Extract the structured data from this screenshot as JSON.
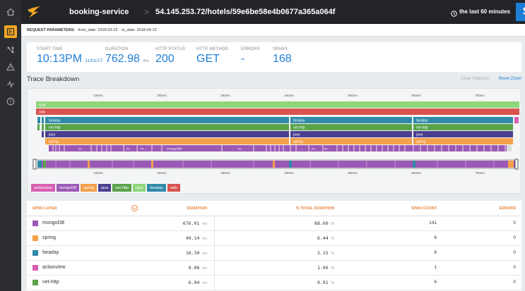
{
  "sidebar": {
    "icons": [
      "home-icon",
      "traces-icon",
      "topology-icon",
      "alerts-icon",
      "metrics-icon",
      "help-icon"
    ]
  },
  "topbar": {
    "service": "booking-service",
    "separator": ">",
    "url": "54.145.253.72/hotels/59e6be58e4b0677a365a064f",
    "time_range": "the last 60 minutes",
    "brand_letter": "S"
  },
  "request": {
    "label": "REQUEST PARAMETERS:",
    "from": "from_date: 2018-03-23",
    "to": "to_date: 2018-04-13"
  },
  "summary": {
    "start_time_label": "START TIME",
    "start_time": "10:13PM",
    "start_date": "11/01/17",
    "duration_label": "DURATION",
    "duration": "762.98",
    "duration_unit": "ms",
    "http_status_label": "HTTP STATUS",
    "http_status": "200",
    "http_method_label": "HTTP METHOD",
    "http_method": "GET",
    "errors_label": "ERRORS",
    "errors": "-",
    "spans_label": "SPANS",
    "spans": "168"
  },
  "trace": {
    "title": "Trace Breakdown",
    "clear_selection": "Clear Selection",
    "reset_zoom": "Reset Zoom",
    "ticks": [
      "100ms",
      "200ms",
      "300ms",
      "400ms",
      "500ms",
      "600ms",
      "700ms"
    ],
    "span_labels": {
      "rack": "rack",
      "rails": "rails",
      "faraday": "faraday",
      "net_http": "net-http",
      "java": "java",
      "spring": "spring",
      "mongodb": "mongoDB",
      "dots": "m...",
      "ellipsis": "..."
    }
  },
  "legend": [
    {
      "label": "actionview",
      "color": "#d95fb3"
    },
    {
      "label": "mongoDB",
      "color": "#9b59b6"
    },
    {
      "label": "spring",
      "color": "#f5a04a"
    },
    {
      "label": "java",
      "color": "#4a3f8f"
    },
    {
      "label": "net-http",
      "color": "#5aa34a"
    },
    {
      "label": "rack",
      "color": "#8dd67a"
    },
    {
      "label": "faraday",
      "color": "#2f8aa8"
    },
    {
      "label": "rails",
      "color": "#d9534f"
    }
  ],
  "table": {
    "headers": {
      "layer": "SPAN LAYER",
      "sort": "▲",
      "duration": "DURATION",
      "pct": "% TOTAL DURATION",
      "count": "SPAN COUNT",
      "errors": "ERRORS"
    },
    "rows": [
      {
        "name": "mongoDB",
        "color": "#9b59b6",
        "duration": "676.01",
        "unit": "ms",
        "pct": "88.60",
        "pct_unit": "%",
        "count": "141",
        "errors": "0"
      },
      {
        "name": "spring",
        "color": "#f5a04a",
        "duration": "49.14",
        "unit": "ms",
        "pct": "6.44",
        "pct_unit": "%",
        "count": "6",
        "errors": "0"
      },
      {
        "name": "faraday",
        "color": "#2f8aa8",
        "duration": "16.39",
        "unit": "ms",
        "pct": "2.15",
        "pct_unit": "%",
        "count": "6",
        "errors": "0"
      },
      {
        "name": "actionview",
        "color": "#d95fb3",
        "duration": "8.06",
        "unit": "ms",
        "pct": "1.06",
        "pct_unit": "%",
        "count": "1",
        "errors": "0"
      },
      {
        "name": "net-http",
        "color": "#5aa34a",
        "duration": "6.94",
        "unit": "ms",
        "pct": "0.91",
        "pct_unit": "%",
        "count": "6",
        "errors": "0"
      }
    ]
  }
}
